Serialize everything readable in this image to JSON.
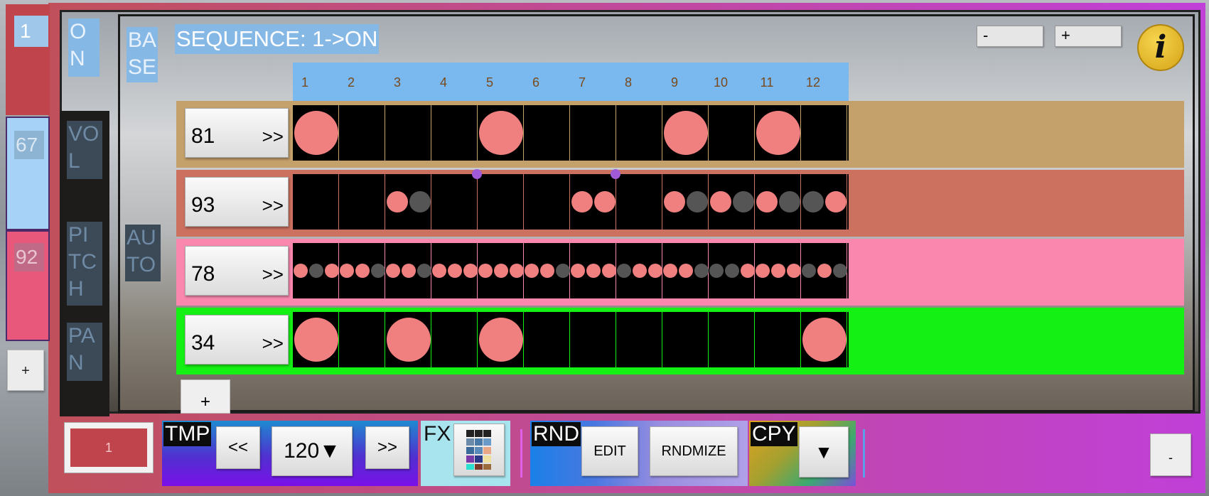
{
  "tracks_sidebar": {
    "items": [
      {
        "label": "1",
        "color": "#c0444c"
      },
      {
        "label": "67",
        "color": "#a5d2f6"
      },
      {
        "label": "92",
        "color": "#e8587a"
      }
    ],
    "add_label": "+"
  },
  "side_controls": {
    "on": "O N",
    "vol": "VO L",
    "pitch": "PI TC H",
    "pan": "PA N",
    "auto": "AU TO",
    "base": "BA SE"
  },
  "sequence_title": "SEQUENCE: 1->ON",
  "zoom": {
    "minus": "-",
    "plus": "+"
  },
  "info_label": "i",
  "steps": [
    "1",
    "2",
    "3",
    "4",
    "5",
    "6",
    "7",
    "8",
    "9",
    "10",
    "11",
    "12"
  ],
  "tracks": [
    {
      "label": "81",
      "arrow": ">>",
      "row_color": "#c4a06a",
      "border_color": "#c4a06a",
      "cells": [
        [
          "big"
        ],
        [],
        [],
        [],
        [
          "big"
        ],
        [],
        [],
        [],
        [
          "big"
        ],
        [],
        [
          "big"
        ],
        []
      ]
    },
    {
      "label": "93",
      "arrow": ">>",
      "row_color": "#cc7060",
      "border_color": "#cc7060",
      "cells": [
        [],
        [],
        [
          "on",
          "off"
        ],
        [],
        [],
        [],
        [
          "on",
          "on"
        ],
        [],
        [
          "on",
          "off"
        ],
        [
          "on",
          "off"
        ],
        [
          "on",
          "off"
        ],
        [
          "off",
          "on"
        ]
      ],
      "markers": [
        4,
        7
      ]
    },
    {
      "label": "78",
      "arrow": ">>",
      "row_color": "#fa88ae",
      "border_color": "#fa88ae",
      "cells": [
        [
          "on",
          "off",
          "on"
        ],
        [
          "on",
          "on",
          "off"
        ],
        [
          "on",
          "on",
          "off"
        ],
        [
          "on",
          "on",
          "on"
        ],
        [
          "on",
          "on",
          "on"
        ],
        [
          "on",
          "on",
          "off"
        ],
        [
          "on",
          "on",
          "on"
        ],
        [
          "off",
          "on",
          "on"
        ],
        [
          "on",
          "on",
          "off"
        ],
        [
          "off",
          "off",
          "on"
        ],
        [
          "on",
          "on",
          "on"
        ],
        [
          "off",
          "on",
          "off"
        ]
      ]
    },
    {
      "label": "34",
      "arrow": ">>",
      "row_color": "#14f014",
      "border_color": "#14f014",
      "cells": [
        [
          "big"
        ],
        [],
        [
          "big"
        ],
        [],
        [
          "big"
        ],
        [],
        [],
        [],
        [],
        [],
        [],
        [
          "big"
        ]
      ]
    }
  ],
  "add_track_label": "+",
  "toolbar": {
    "pattern_label": "1",
    "tmp": {
      "tag": "TMP",
      "prev": "<<",
      "tempo": "120▼",
      "next": ">>"
    },
    "fx": {
      "tag": "FX"
    },
    "rnd": {
      "tag": "RND",
      "edit": "EDIT",
      "randomize": "RNDMIZE"
    },
    "cpy": {
      "tag": "CPY",
      "dropdown": "▼"
    },
    "collapse": "-"
  },
  "colors": {
    "dot_on": "#f08080",
    "dot_off": "#555555",
    "step_header": "#7ab8f0"
  }
}
